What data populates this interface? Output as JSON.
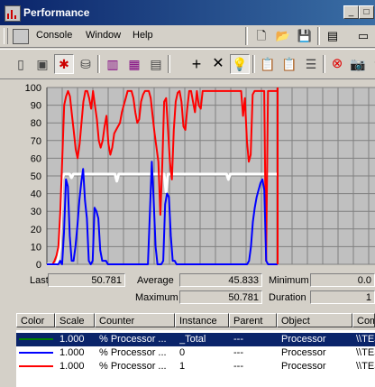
{
  "window": {
    "title": "Performance"
  },
  "menu": {
    "items": [
      "Console",
      "Window",
      "Help"
    ]
  },
  "chart_data": {
    "type": "line",
    "ylim": [
      0,
      100
    ],
    "yticks": [
      100,
      90,
      80,
      70,
      60,
      50,
      40,
      30,
      20,
      10,
      0
    ],
    "grid": true,
    "series": [
      {
        "color": "#ffffff",
        "values": [
          0,
          0,
          0,
          0,
          0,
          0,
          3,
          10,
          48,
          51,
          51,
          51,
          51,
          49,
          51,
          51,
          51,
          51,
          51,
          51,
          51,
          51,
          51,
          51,
          51,
          51,
          51,
          51,
          51,
          51,
          51,
          51,
          51,
          51,
          51,
          51,
          51,
          47,
          51,
          51,
          51,
          51,
          51,
          51,
          51,
          51,
          51,
          51,
          51,
          51,
          51,
          51,
          51,
          51,
          51,
          51,
          51,
          51,
          51,
          51,
          51,
          51,
          51,
          41,
          51,
          51,
          51,
          51,
          51,
          51,
          51,
          51,
          51,
          51,
          51,
          51,
          51,
          51,
          51,
          51,
          51,
          51,
          51,
          51,
          51,
          51,
          51,
          51,
          51,
          51,
          51,
          51,
          51,
          51,
          51,
          51,
          48,
          51,
          51,
          51,
          51,
          51,
          51,
          51,
          51,
          51,
          51,
          51,
          51,
          51,
          51,
          51,
          51,
          51,
          51,
          51,
          51,
          51,
          51,
          51,
          51,
          51,
          51
        ]
      },
      {
        "color": "#ff0000",
        "values": [
          0,
          0,
          0,
          0,
          2,
          5,
          10,
          30,
          60,
          90,
          95,
          98,
          95,
          85,
          75,
          65,
          60,
          68,
          80,
          92,
          98,
          98,
          94,
          88,
          98,
          90,
          82,
          70,
          66,
          70,
          78,
          84,
          68,
          62,
          66,
          74,
          76,
          78,
          80,
          86,
          90,
          94,
          98,
          98,
          98,
          94,
          86,
          80,
          82,
          92,
          96,
          98,
          98,
          98,
          94,
          84,
          74,
          66,
          58,
          28,
          56,
          92,
          94,
          76,
          58,
          48,
          76,
          92,
          97,
          98,
          92,
          78,
          76,
          88,
          98,
          98,
          92,
          86,
          98,
          90,
          88,
          98,
          98,
          98,
          98,
          98,
          98,
          98,
          98,
          98,
          98,
          98,
          98,
          98,
          98,
          98,
          98,
          98,
          98,
          98,
          98,
          98,
          84,
          94,
          70,
          58,
          62,
          96,
          98,
          98,
          98,
          98,
          98,
          98,
          2,
          98,
          98,
          98,
          98,
          98,
          98
        ]
      },
      {
        "color": "#0000ff",
        "values": [
          0,
          0,
          0,
          0,
          0,
          0,
          0,
          2,
          0,
          18,
          48,
          44,
          16,
          2,
          2,
          10,
          22,
          36,
          46,
          54,
          36,
          26,
          2,
          0,
          2,
          32,
          30,
          26,
          8,
          2,
          2,
          2,
          0,
          0,
          0,
          0,
          0,
          0,
          0,
          0,
          0,
          0,
          0,
          0,
          0,
          0,
          0,
          0,
          0,
          0,
          0,
          0,
          0,
          0,
          28,
          58,
          36,
          10,
          0,
          0,
          0,
          2,
          34,
          40,
          38,
          16,
          2,
          2,
          0,
          0,
          0,
          0,
          0,
          0,
          0,
          0,
          0,
          0,
          0,
          0,
          0,
          0,
          0,
          0,
          0,
          0,
          0,
          0,
          0,
          0,
          0,
          0,
          0,
          0,
          0,
          0,
          0,
          0,
          0,
          0,
          0,
          0,
          0,
          0,
          0,
          0,
          2,
          10,
          24,
          32,
          38,
          42,
          46,
          48,
          42,
          2,
          0,
          0,
          0,
          0,
          0,
          0
        ]
      }
    ]
  },
  "stats": {
    "last_label": "Last",
    "last_value": "50.781",
    "average_label": "Average",
    "average_value": "45.833",
    "minimum_label": "Minimum",
    "minimum_value": "0.0",
    "maximum_label": "Maximum",
    "maximum_value": "50.781",
    "duration_label": "Duration",
    "duration_value": "1"
  },
  "list": {
    "headers": [
      "Color",
      "Scale",
      "Counter",
      "Instance",
      "Parent",
      "Object",
      "Com"
    ],
    "rows": [
      {
        "color": "#008000",
        "scale": "1.000",
        "counter": "% Processor ...",
        "instance": "_Total",
        "parent": "---",
        "object": "Processor",
        "computer": "\\\\TES",
        "selected": true
      },
      {
        "color": "#0000ff",
        "scale": "1.000",
        "counter": "% Processor ...",
        "instance": "0",
        "parent": "---",
        "object": "Processor",
        "computer": "\\\\TES",
        "selected": false
      },
      {
        "color": "#ff0000",
        "scale": "1.000",
        "counter": "% Processor ...",
        "instance": "1",
        "parent": "---",
        "object": "Processor",
        "computer": "\\\\TES",
        "selected": false
      }
    ]
  }
}
